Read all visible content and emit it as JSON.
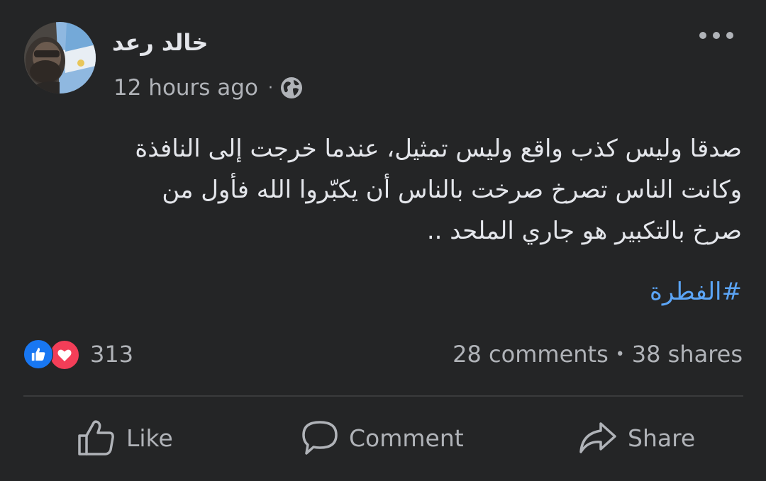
{
  "post": {
    "author": "خالد رعد",
    "timestamp": "12 hours ago",
    "meta_separator": "·",
    "privacy_icon": "globe-icon",
    "more_icon": "more-options-icon",
    "body_lines": [
      "صدقا وليس كذب واقع وليس تمثيل، عندما خرجت إلى النافذة",
      "وكانت الناس تصرخ صرخت بالناس أن يكبّروا الله فأول من",
      "صرخ بالتكبير هو جاري الملحد .."
    ],
    "hashtag": "#الفطرة"
  },
  "stats": {
    "reaction_count": "313",
    "reaction_icons": [
      "like-reaction-icon",
      "love-reaction-icon"
    ],
    "comments": "28 comments",
    "separator": "•",
    "shares": "38 shares"
  },
  "actions": {
    "like_label": "Like",
    "comment_label": "Comment",
    "share_label": "Share"
  },
  "colors": {
    "background": "#242526",
    "text_primary": "#e4e6eb",
    "text_secondary": "#b0b3b8",
    "hashtag": "#5ba4f5",
    "like_blue": "#1877f2",
    "love_red": "#f33e58",
    "divider": "#3a3b3c"
  }
}
